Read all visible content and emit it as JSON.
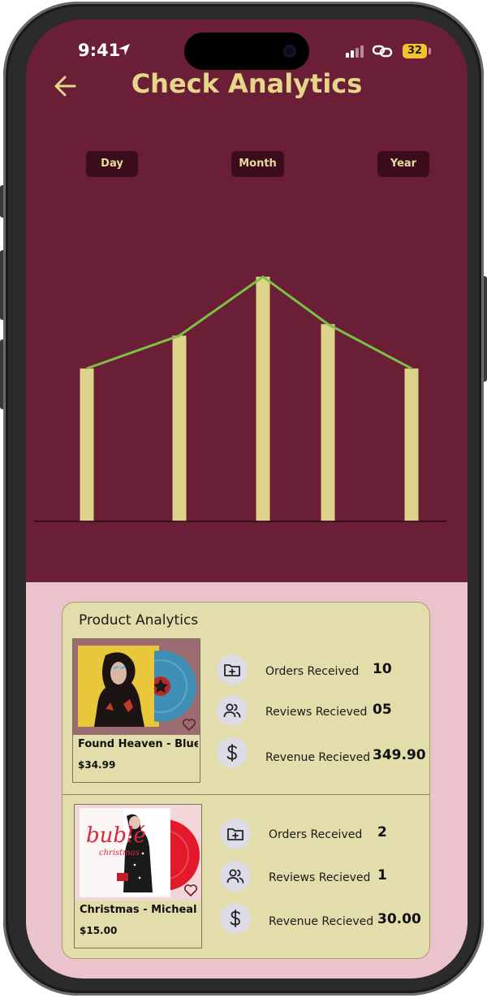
{
  "status_bar": {
    "time": "9:41",
    "battery": "32"
  },
  "header": {
    "title": "Check Analytics"
  },
  "period_tabs": [
    {
      "label": "Day"
    },
    {
      "label": "Month"
    },
    {
      "label": "Year"
    }
  ],
  "chart_data": {
    "type": "bar",
    "categories": [
      "",
      "",
      "",
      "",
      ""
    ],
    "values": [
      200,
      243,
      320,
      258,
      200
    ],
    "line_overlay": true,
    "ylim": [
      0,
      340
    ],
    "xlabel": "",
    "ylabel": "",
    "title": "",
    "colors": {
      "bar": "#ddd38a",
      "line": "#7cc242",
      "axis": "#2a0a14"
    }
  },
  "analytics": {
    "title": "Product Analytics",
    "stat_labels": {
      "orders": "Orders Received",
      "reviews": "Reviews Recieved",
      "revenue": "Revenue Recieved"
    },
    "products": [
      {
        "name": "Found Heaven - Blue",
        "price": "$34.99",
        "orders": "10",
        "reviews": "05",
        "revenue": "349.90"
      },
      {
        "name": "Christmas - Micheal B..",
        "price": "$15.00",
        "orders": "2",
        "reviews": "1",
        "revenue": "30.00"
      }
    ]
  },
  "colors": {
    "header_bg": "#6b1f36",
    "title": "#e6d68a",
    "bottom_bg": "#ebc3cd",
    "card_bg": "#e3dcab",
    "tab_bg": "#3b0d1b"
  }
}
